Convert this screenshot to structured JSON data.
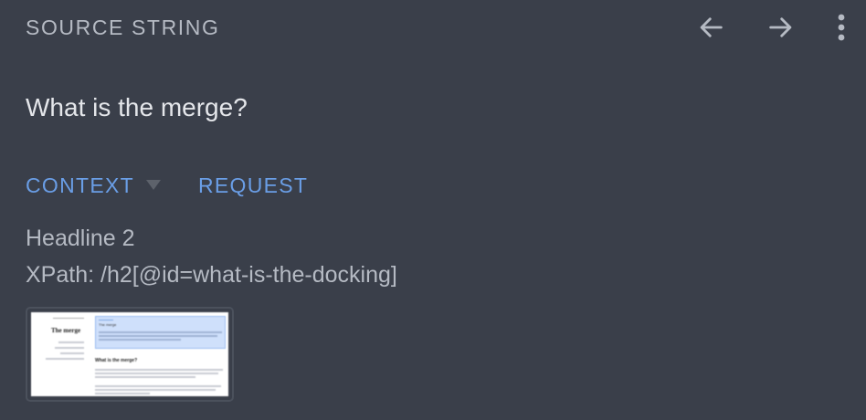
{
  "header": {
    "title": "SOURCE STRING"
  },
  "source": {
    "text": "What is the merge?"
  },
  "tabs": {
    "context_label": "CONTEXT",
    "request_label": "REQUEST"
  },
  "context": {
    "element_type": "Headline 2",
    "xpath": "XPath: /h2[@id=what-is-the-docking]"
  },
  "screenshot": {
    "page_title": "The merge",
    "callout_title": "The merge",
    "section_title": "What is the merge?"
  },
  "colors": {
    "background": "#3a3f4a",
    "accent": "#6a9ee6",
    "muted_text": "#b5bac3"
  }
}
